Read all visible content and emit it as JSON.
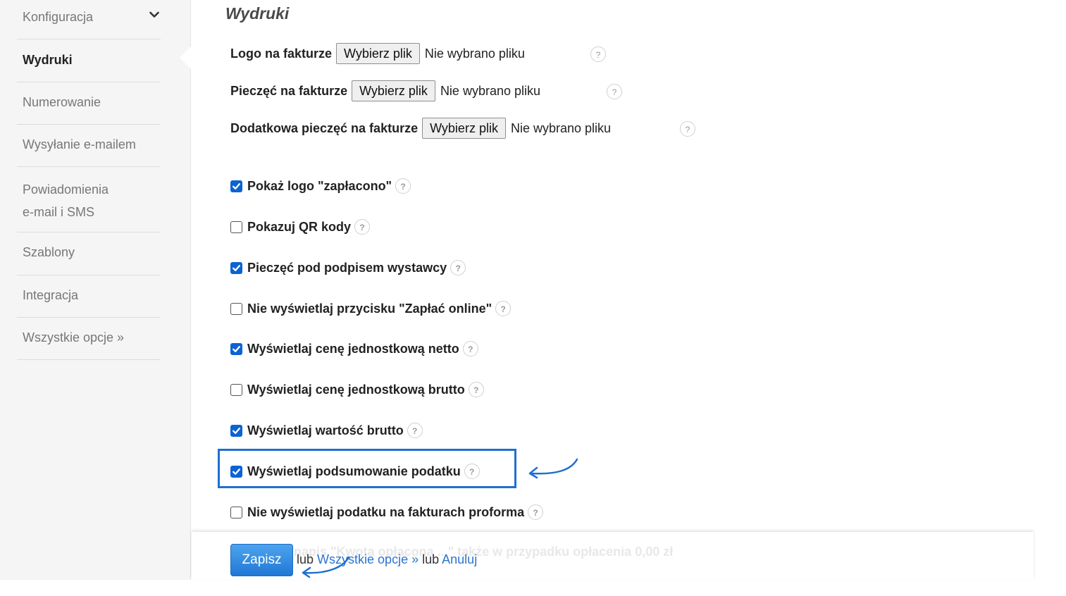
{
  "sidebar": {
    "items": [
      {
        "label": "Konfiguracja"
      },
      {
        "label": "Wydruki"
      },
      {
        "label": "Numerowanie"
      },
      {
        "label": "Wysyłanie e-mailem"
      },
      {
        "label_line1": "Powiadomienia",
        "label_line2": "e-mail i SMS"
      },
      {
        "label": "Szablony"
      },
      {
        "label": "Integracja"
      },
      {
        "label": "Wszystkie opcje »"
      }
    ],
    "active_item": "Wydruki",
    "expand_icon": "chevron-down-icon"
  },
  "main": {
    "title": "Wydruki",
    "file_fields": [
      {
        "label": "Logo na fakturze",
        "button": "Wybierz plik",
        "status": "Nie wybrano pliku"
      },
      {
        "label": "Pieczęć na fakturze",
        "button": "Wybierz plik",
        "status": "Nie wybrano pliku"
      },
      {
        "label": "Dodatkowa pieczęć na fakturze",
        "button": "Wybierz plik",
        "status": "Nie wybrano pliku"
      }
    ],
    "checkboxes": [
      {
        "label": "Pokaż logo \"zapłacono\"",
        "checked": true
      },
      {
        "label": "Pokazuj QR kody",
        "checked": false
      },
      {
        "label": "Pieczęć pod podpisem wystawcy",
        "checked": true
      },
      {
        "label": "Nie wyświetlaj przycisku \"Zapłać online\"",
        "checked": false
      },
      {
        "label": "Wyświetlaj cenę jednostkową netto",
        "checked": true
      },
      {
        "label": "Wyświetlaj cenę jednostkową brutto",
        "checked": false
      },
      {
        "label": "Wyświetlaj wartość brutto",
        "checked": true
      },
      {
        "label": "Wyświetlaj podsumowanie podatku",
        "checked": true,
        "highlighted": true
      },
      {
        "label": "Nie wyświetlaj podatku na fakturach proforma",
        "checked": false
      },
      {
        "label": "Wstaw napis \"Kwota opłacona ...\" także w przypadku opłacenia 0,00 zł",
        "checked": false,
        "obscured": true
      }
    ],
    "help_glyph": "?"
  },
  "footer": {
    "save_label": "Zapisz",
    "or_text_1": "lub",
    "all_options_link": "Wszystkie opcje »",
    "or_text_2": "lub",
    "cancel_link": "Anuluj"
  },
  "colors": {
    "accent": "#1f6fd1",
    "checkbox_on": "#0b63d4",
    "sidebar_bg": "#f5f5f5",
    "link": "#2a74d1"
  }
}
